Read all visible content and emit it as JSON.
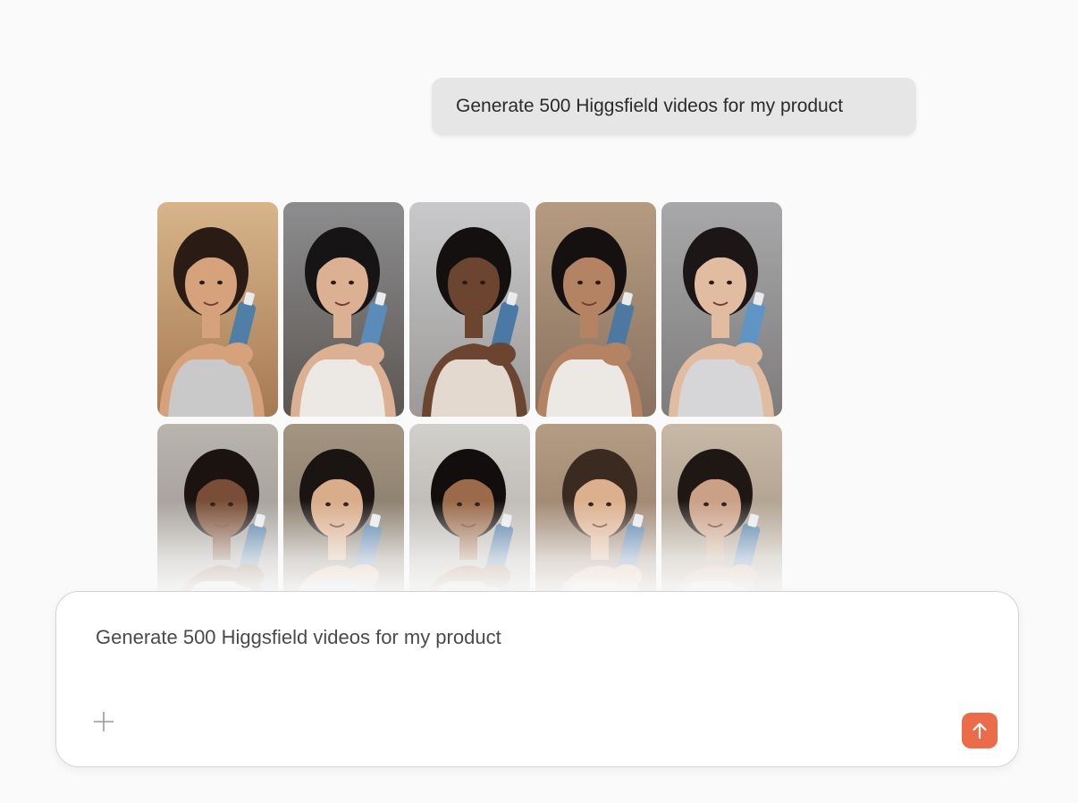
{
  "chat": {
    "user_message": "Generate 500 Higgsfield videos for my product"
  },
  "results": {
    "videos": [
      {
        "bgA": "#d7b48a",
        "bgB": "#a67a52",
        "skin": "#d6a27c",
        "hair": "#2a1c15",
        "top": "#c9c9c9",
        "bottle": "#4f7ea6"
      },
      {
        "bgA": "#8d8d8f",
        "bgB": "#5b5652",
        "skin": "#dcb193",
        "hair": "#161414",
        "top": "#ece8e4",
        "bottle": "#5b8bb8"
      },
      {
        "bgA": "#c9c9cb",
        "bgB": "#9c9a98",
        "skin": "#6b4530",
        "hair": "#141010",
        "top": "#e3d9ce",
        "bottle": "#4b79a6"
      },
      {
        "bgA": "#b59b80",
        "bgB": "#8a7260",
        "skin": "#b48364",
        "hair": "#151111",
        "top": "#ece8e4",
        "bottle": "#4c78a2"
      },
      {
        "bgA": "#a8a8aa",
        "bgB": "#7e7c7b",
        "skin": "#e1bca0",
        "hair": "#1c1716",
        "top": "#d6d6d8",
        "bottle": "#5f95c4"
      },
      {
        "bgA": "#b8b4ae",
        "bgB": "#8f8882",
        "skin": "#7a4e36",
        "hair": "#1b1310",
        "top": "#d8d8d8",
        "bottle": "#4a769f"
      },
      {
        "bgA": "#a39580",
        "bgB": "#6f6458",
        "skin": "#d9ac8a",
        "hair": "#1a1412",
        "top": "#aebfd6",
        "bottle": "#4c7aa6"
      },
      {
        "bgA": "#d2d0cc",
        "bgB": "#a29d96",
        "skin": "#9a6a4a",
        "hair": "#120e0d",
        "top": "#c8c4a4",
        "bottle": "#4b78a4"
      },
      {
        "bgA": "#b59c84",
        "bgB": "#836c5a",
        "skin": "#dcb08e",
        "hair": "#3a2a20",
        "top": "#d9d2c9",
        "bottle": "#4e7ba6"
      },
      {
        "bgA": "#c7b9a6",
        "bgB": "#938473",
        "skin": "#caa086",
        "hair": "#1f1714",
        "top": "#d7d5d2",
        "bottle": "#4b79a6"
      }
    ]
  },
  "composer": {
    "input_value": "Generate 500 Higgsfield videos for my product",
    "add_icon": "plus-icon",
    "send_icon": "arrow-up-icon",
    "send_color": "#ea6c4a"
  }
}
